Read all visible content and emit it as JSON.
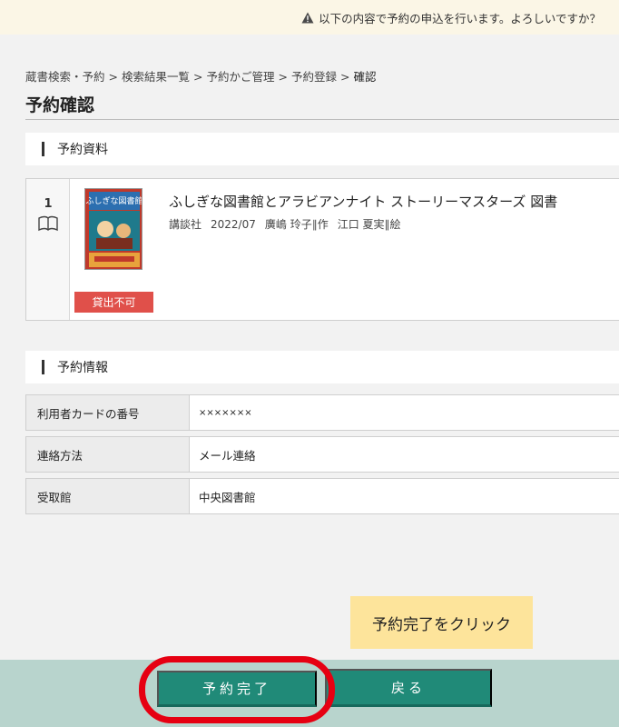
{
  "notice": {
    "text": "以下の内容で予約の申込を行います。よろしいですか？"
  },
  "breadcrumb": {
    "items": [
      "蔵書検索・予約",
      "検索結果一覧",
      "予約かご管理",
      "予約登録"
    ],
    "current": "確認",
    "separator": ">"
  },
  "page": {
    "title": "予約確認"
  },
  "materials": {
    "heading": "予約資料",
    "items": [
      {
        "number": "1",
        "title": "ふしぎな図書館とアラビアンナイト ストーリーマスターズ 図書",
        "publisher": "講談社",
        "date": "2022/07",
        "author": "廣嶋 玲子∥作",
        "illustrator": "江口 夏実∥絵",
        "status": "貸出不可",
        "cover_text": "ふしぎな図書館"
      }
    ]
  },
  "reservation": {
    "heading": "予約情報",
    "rows": [
      {
        "label": "利用者カードの番号",
        "value": "×××××××"
      },
      {
        "label": "連絡方法",
        "value": "メール連絡"
      },
      {
        "label": "受取館",
        "value": "中央図書館"
      }
    ]
  },
  "hint": {
    "text": "予約完了をクリック"
  },
  "actions": {
    "complete_label": "予約完了",
    "back_label": "戻る"
  },
  "colors": {
    "accent": "#208a78",
    "danger": "#e0504a",
    "highlight": "#e60012",
    "hint_bg": "#fde49b"
  }
}
